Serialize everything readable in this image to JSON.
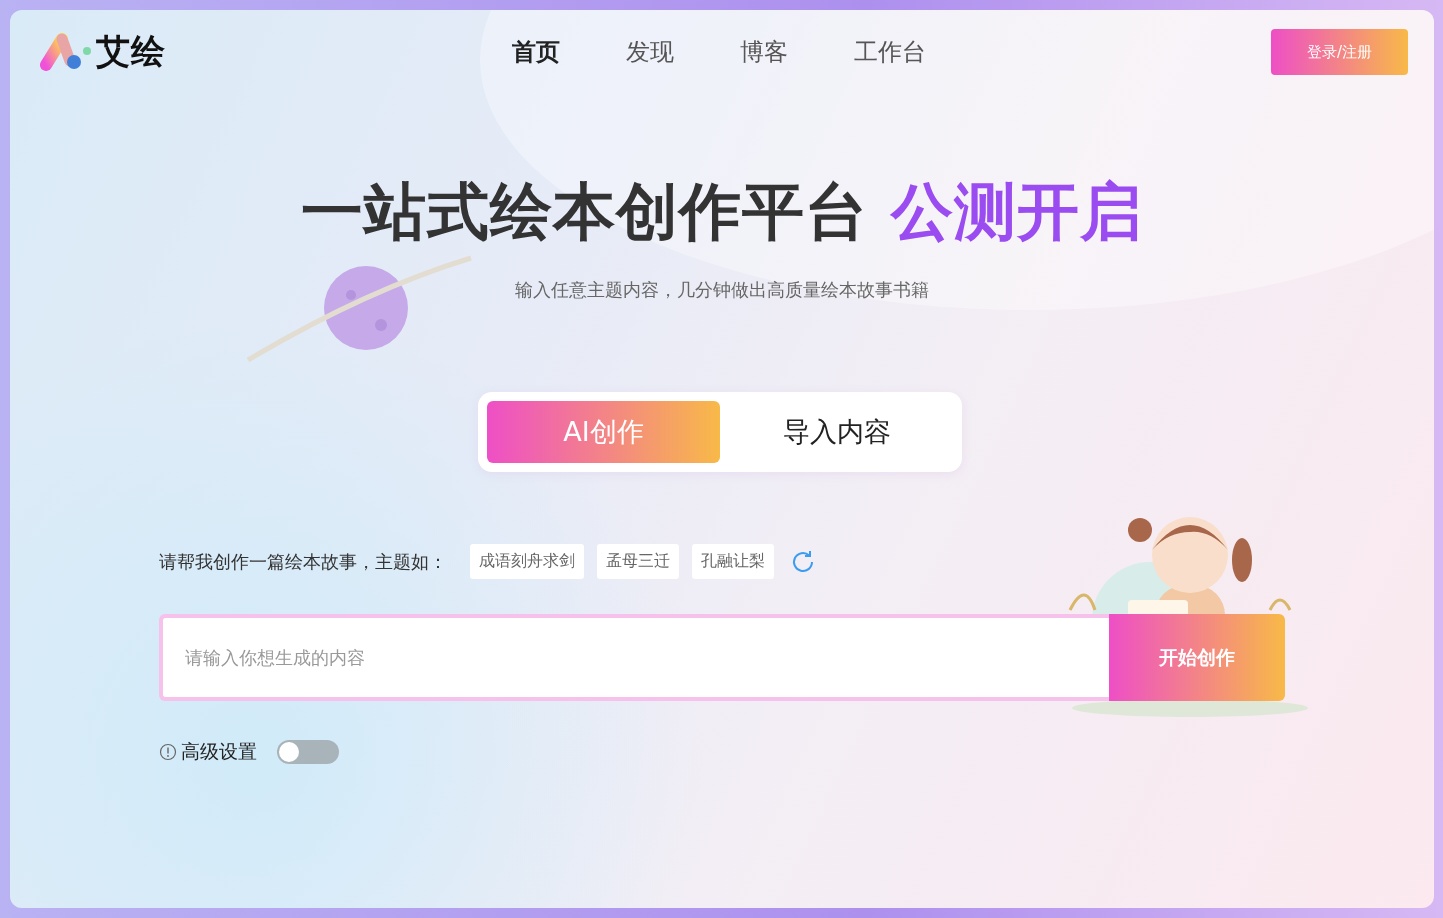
{
  "logo": {
    "text": "艾绘"
  },
  "nav": [
    {
      "label": "首页",
      "selected": true
    },
    {
      "label": "发现",
      "selected": false
    },
    {
      "label": "博客",
      "selected": false
    },
    {
      "label": "工作台",
      "selected": false
    }
  ],
  "login_button": "登录/注册",
  "headline": {
    "main": "一站式绘本创作平台",
    "highlight": "公测开启"
  },
  "subtitle": "输入任意主题内容，几分钟做出高质量绘本故事书籍",
  "tabs": [
    {
      "label": "AI创作",
      "selected": true
    },
    {
      "label": "导入内容",
      "selected": false
    }
  ],
  "prompt_label": "请帮我创作一篇绘本故事，主题如：",
  "topics": [
    "成语刻舟求剑",
    "孟母三迁",
    "孔融让梨"
  ],
  "input": {
    "placeholder": "请输入你想生成的内容"
  },
  "submit_button": "开始创作",
  "advanced": {
    "label": "高级设置",
    "on": false
  }
}
